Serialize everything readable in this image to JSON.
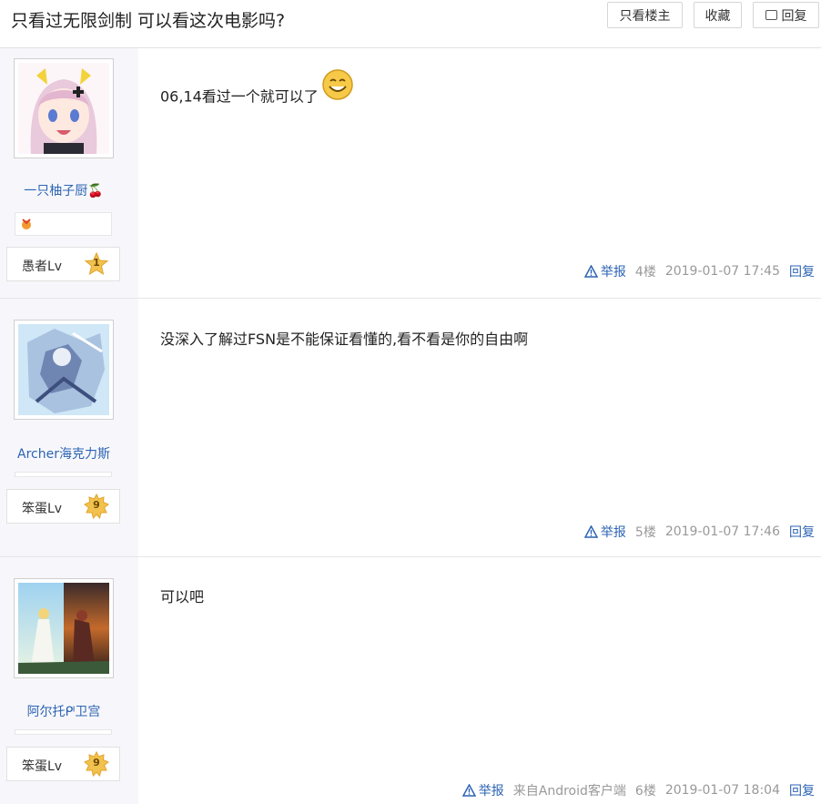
{
  "thread": {
    "title": "只看过无限剑制 可以看这次电影吗?",
    "buttons": {
      "only_op": "只看楼主",
      "favorite": "收藏",
      "reply": "回复"
    }
  },
  "posts": [
    {
      "user": "一只柚子厨🍒",
      "level_title": "愚者Lv",
      "level": "1",
      "content": "06,14看过一个就可以了",
      "report": "举报",
      "source": "",
      "floor": "4楼",
      "time": "2019-01-07 17:45",
      "reply": "回复"
    },
    {
      "user": "Archer海克力斯",
      "level_title": "笨蛋Lv",
      "level": "9",
      "content": "没深入了解过FSN是不能保证看懂的,看不看是你的自由啊",
      "report": "举报",
      "source": "",
      "floor": "5楼",
      "time": "2019-01-07 17:46",
      "reply": "回复"
    },
    {
      "user": "阿尔托ᒆ卫宫",
      "level_title": "笨蛋Lv",
      "level": "9",
      "content": "可以吧",
      "report": "举报",
      "source": "来自Android客户端",
      "floor": "6楼",
      "time": "2019-01-07 18:04",
      "reply": "回复"
    }
  ],
  "colors": {
    "link": "#2d64b3",
    "star": "#f2c14e"
  },
  "icons": [
    "reply-icon",
    "warning-icon",
    "star-icon",
    "smile-emoji-icon",
    "medal-icon"
  ]
}
